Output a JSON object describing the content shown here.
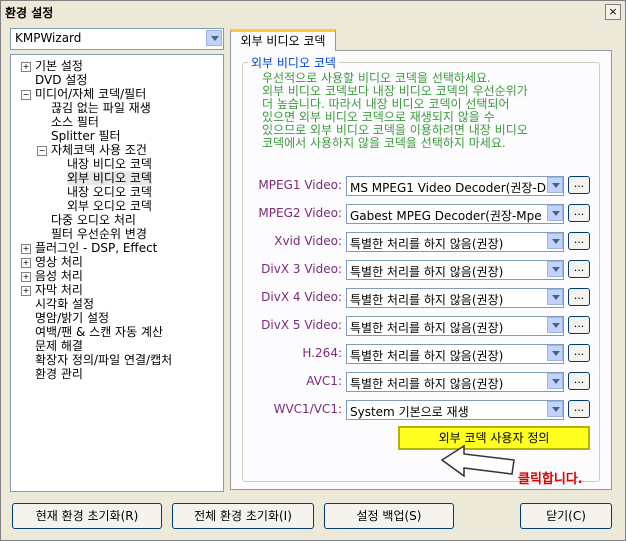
{
  "window": {
    "title": "환경 설정",
    "close": "×"
  },
  "combo": {
    "value": "KMPWizard"
  },
  "tree": [
    {
      "label": "기본 설정",
      "expander": "+"
    },
    {
      "label": "DVD 설정",
      "expander": ""
    },
    {
      "label": "미디어/자체 코덱/필터",
      "expander": "−"
    },
    {
      "label": "끊김 없는 파일 재생",
      "expander": ""
    },
    {
      "label": "소스 필터",
      "expander": ""
    },
    {
      "label": "Splitter 필터",
      "expander": ""
    },
    {
      "label": "자체코덱 사용 조건",
      "expander": "−"
    },
    {
      "label": "내장 비디오 코덱",
      "expander": ""
    },
    {
      "label": "외부 비디오 코덱",
      "expander": ""
    },
    {
      "label": "내장 오디오 코덱",
      "expander": ""
    },
    {
      "label": "외부 오디오 코덱",
      "expander": ""
    },
    {
      "label": "다중 오디오 처리",
      "expander": ""
    },
    {
      "label": "필터 우선순위 변경",
      "expander": ""
    },
    {
      "label": "플러그인 - DSP, Effect",
      "expander": "+"
    },
    {
      "label": "영상 처리",
      "expander": "+"
    },
    {
      "label": "음성 처리",
      "expander": "+"
    },
    {
      "label": "자막 처리",
      "expander": "+"
    },
    {
      "label": "시각화 설정",
      "expander": ""
    },
    {
      "label": "명암/밝기 설정",
      "expander": ""
    },
    {
      "label": "여백/팬 & 스캔 자동 계산",
      "expander": ""
    },
    {
      "label": "문제 해결",
      "expander": ""
    },
    {
      "label": "확장자 정의/파일 연결/캡처",
      "expander": ""
    },
    {
      "label": "환경 관리",
      "expander": ""
    }
  ],
  "tab": {
    "label": "외부 비디오 코덱"
  },
  "group": {
    "title": "외부 비디오 코덱",
    "description": [
      "우선적으로 사용할 비디오 코덱을 선택하세요.",
      "외부 비디오 코덱보다 내장 비디오 코덱의 우선순위가",
      "더 높습니다. 따라서 내장 비디오 코덱이 선택되어",
      "있으면 외부 비디오 코덱으로 재생되지 않을 수",
      "있으므로 외부 비디오 코덱을 이용하려면 내장 비디오",
      "코덱에서 사용하지 않을 코덱을 선택하지 마세요."
    ]
  },
  "codecs": [
    {
      "label": "MPEG1 Video:",
      "value": "MS MPEG1 Video Decoder(권장-D"
    },
    {
      "label": "MPEG2 Video:",
      "value": "Gabest MPEG Decoder(권장-Mpe"
    },
    {
      "label": "Xvid Video:",
      "value": "특별한 처리를 하지 않음(권장)"
    },
    {
      "label": "DivX 3 Video:",
      "value": "특별한 처리를 하지 않음(권장)"
    },
    {
      "label": "DivX 4 Video:",
      "value": "특별한 처리를 하지 않음(권장)"
    },
    {
      "label": "DivX 5 Video:",
      "value": "특별한 처리를 하지 않음(권장)"
    },
    {
      "label": "H.264:",
      "value": "특별한 처리를 하지 않음(권장)"
    },
    {
      "label": "AVC1:",
      "value": "특별한 처리를 하지 않음(권장)"
    },
    {
      "label": "WVC1/VC1:",
      "value": "System 기본으로 재생"
    }
  ],
  "dots_label": "...",
  "custom_button": "외부 코덱 사용자 정의",
  "annotation": "클릭합니다.",
  "buttons": {
    "reset_current": "현재 환경 초기화(R)",
    "reset_all": "전체 환경 초기화(I)",
    "backup": "설정 백업(S)",
    "close": "닫기(C)"
  }
}
